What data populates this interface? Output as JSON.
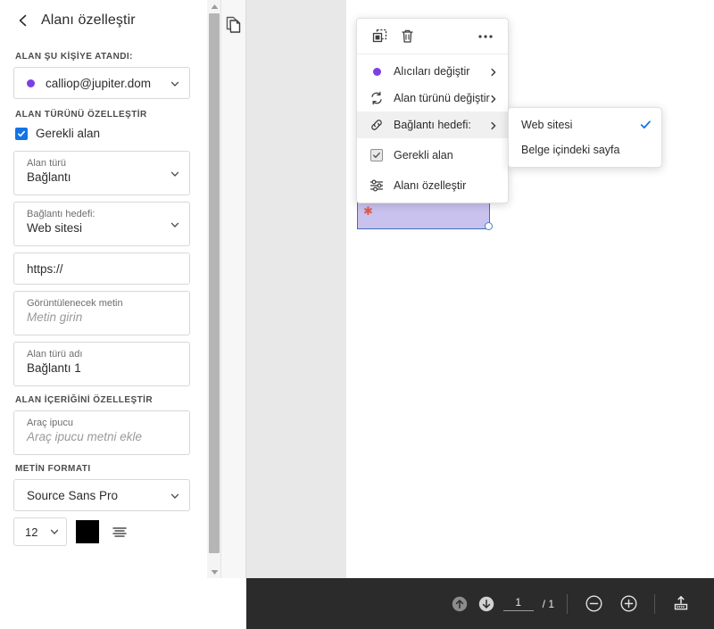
{
  "sidebar": {
    "back_icon": "chevron-left-icon",
    "title": "Alanı özelleştir",
    "assigned_section_label": "ALAN ŞU KİŞİYE ATANDI:",
    "assignee": {
      "value": "calliop@jupiter.dom",
      "dot_color": "#7b3fe4",
      "chevron_icon": "chevron-down-icon"
    },
    "field_type_section_label": "ALAN TÜRÜNÜ ÖZELLEŞTİR",
    "required_checkbox": {
      "label": "Gerekli alan",
      "checked": true,
      "color": "#1473e6"
    },
    "fields": [
      {
        "label": "Alan türü",
        "value": "Bağlantı",
        "type": "select"
      },
      {
        "label": "Bağlantı hedefi:",
        "value": "Web sitesi",
        "type": "select"
      },
      {
        "label": "",
        "value": "https://",
        "type": "text"
      },
      {
        "label": "Görüntülenecek metin",
        "value": "Metin girin",
        "type": "text-placeholder"
      },
      {
        "label": "Alan türü adı",
        "value": "Bağlantı 1",
        "type": "text"
      }
    ],
    "content_section_label": "ALAN İÇERİĞİNİ ÖZELLEŞTİR",
    "tooltip_field": {
      "label": "Araç ipucu",
      "value": "Araç ipucu metni ekle"
    },
    "text_format_section_label": "METİN FORMATI",
    "font_family": "Source Sans Pro",
    "font_size": "12",
    "font_color": "#000000",
    "align_icon": "text-align-icon"
  },
  "scrollbar": {
    "up_icon": "scroll-up-arrow-icon",
    "down_icon": "scroll-down-arrow-icon"
  },
  "thumbnail_rail": {
    "pages_icon": "pages-thumbnail-icon"
  },
  "document": {
    "form_field": {
      "required_marker": "✱",
      "fill_color": "#c9c2ee",
      "border_color": "#3f6fb5"
    }
  },
  "context_menu": {
    "toolbar": [
      {
        "icon": "duplicate-icon",
        "name": "duplicate-field-button"
      },
      {
        "icon": "trash-icon",
        "name": "delete-field-button"
      },
      {
        "icon": "more-options-icon",
        "name": "more-options-button"
      }
    ],
    "items": [
      {
        "icon": "purple-dot-icon",
        "label": "Alıcıları değiştir",
        "has_submenu": true
      },
      {
        "icon": "refresh-swap-icon",
        "label": "Alan türünü değiştir",
        "has_submenu": true
      },
      {
        "icon": "link-icon",
        "label": "Bağlantı hedefi:",
        "has_submenu": true,
        "active": true
      },
      {
        "icon": "checkbox-checked-icon",
        "label": "Gerekli alan",
        "has_submenu": false
      },
      {
        "icon": "sliders-icon",
        "label": "Alanı özelleştir",
        "has_submenu": false
      }
    ]
  },
  "submenu": {
    "items": [
      {
        "label": "Web sitesi",
        "selected": true
      },
      {
        "label": "Belge içindeki sayfa",
        "selected": false
      }
    ],
    "check_icon": "checkmark-icon",
    "check_color": "#1473e6"
  },
  "bottom_bar": {
    "prev_page_icon": "arrow-up-circle-icon",
    "next_page_icon": "arrow-down-circle-icon",
    "current_page": "1",
    "page_separator": "/ 1",
    "zoom_out_icon": "minus-circle-icon",
    "zoom_in_icon": "plus-circle-icon",
    "fit_icon": "fit-page-icon"
  }
}
